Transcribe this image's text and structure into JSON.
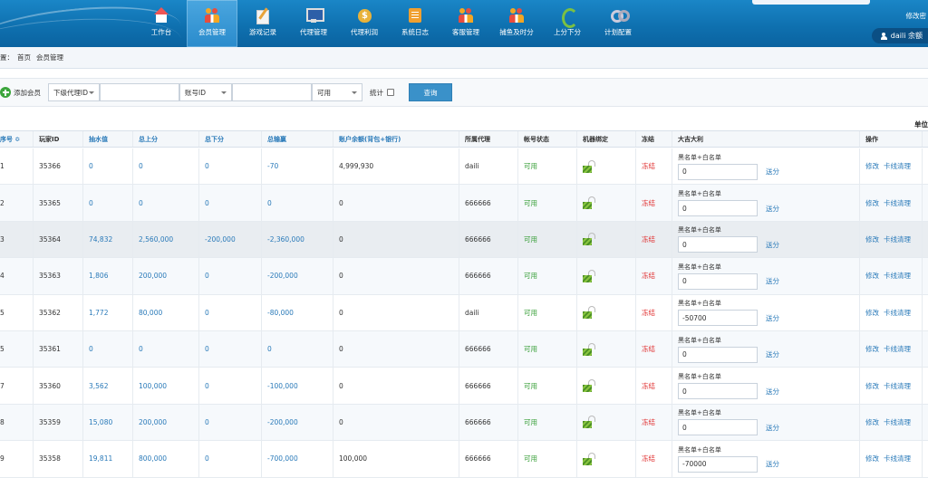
{
  "header": {
    "nav": [
      {
        "label": "工作台",
        "icon": "home-icon",
        "cls": "ico-home"
      },
      {
        "label": "会员管理",
        "icon": "members-icon",
        "cls": "ico-people",
        "active": true
      },
      {
        "label": "游戏记录",
        "icon": "edit-icon",
        "cls": "ico-edit"
      },
      {
        "label": "代理管理",
        "icon": "monitor-icon",
        "cls": "ico-monitor"
      },
      {
        "label": "代理利润",
        "icon": "money-bag-icon",
        "cls": "ico-money"
      },
      {
        "label": "系统日志",
        "icon": "log-icon",
        "cls": "ico-log"
      },
      {
        "label": "客服管理",
        "icon": "service-icon",
        "cls": "ico-people"
      },
      {
        "label": "捕鱼及时分",
        "icon": "fish-icon",
        "cls": "ico-people"
      },
      {
        "label": "上分下分",
        "icon": "refresh-icon",
        "cls": "ico-refresh"
      },
      {
        "label": "计划配置",
        "icon": "gear-icon",
        "cls": "ico-gear"
      }
    ],
    "change_password": "修改密",
    "user": "daili 余额"
  },
  "breadcrumb": {
    "prefix": "置：",
    "home": "首页",
    "current": "会员管理"
  },
  "toolbar": {
    "add_member": "添加会员",
    "agent_select": "下级代理ID",
    "account_select": "账号ID",
    "status_select": "可用",
    "stats_label": "统计",
    "query": "查询"
  },
  "unit_label": "单位",
  "table": {
    "headers": [
      "序号 ≎",
      "玩家ID",
      "抽水值",
      "总上分",
      "总下分",
      "总输赢",
      "账户余额(背包+银行)",
      "所属代理",
      "帐号状态",
      "机器绑定",
      "冻结",
      "大吉大利",
      "操作"
    ],
    "rows": [
      {
        "no": "1",
        "id": "35366",
        "rake": "0",
        "up": "0",
        "down": "0",
        "net": "-70",
        "balance": "4,999,930",
        "agent": "daili",
        "status": "可用",
        "freeze": "冻结",
        "bw_label": "黑名单+白名单",
        "bw_value": "0",
        "send": "送分",
        "edit": "修改",
        "clear": "卡线清理"
      },
      {
        "no": "2",
        "id": "35365",
        "rake": "0",
        "up": "0",
        "down": "0",
        "net": "0",
        "balance": "0",
        "agent": "666666",
        "status": "可用",
        "freeze": "冻结",
        "bw_label": "黑名单+白名单",
        "bw_value": "0",
        "send": "送分",
        "edit": "修改",
        "clear": "卡线清理"
      },
      {
        "no": "3",
        "id": "35364",
        "rake": "74,832",
        "up": "2,560,000",
        "down": "-200,000",
        "net": "-2,360,000",
        "balance": "0",
        "agent": "666666",
        "status": "可用",
        "freeze": "冻结",
        "bw_label": "黑名单+白名单",
        "bw_value": "0",
        "send": "送分",
        "edit": "修改",
        "clear": "卡线清理"
      },
      {
        "no": "4",
        "id": "35363",
        "rake": "1,806",
        "up": "200,000",
        "down": "0",
        "net": "-200,000",
        "balance": "0",
        "agent": "666666",
        "status": "可用",
        "freeze": "冻结",
        "bw_label": "黑名单+白名单",
        "bw_value": "0",
        "send": "送分",
        "edit": "修改",
        "clear": "卡线清理"
      },
      {
        "no": "5",
        "id": "35362",
        "rake": "1,772",
        "up": "80,000",
        "down": "0",
        "net": "-80,000",
        "balance": "0",
        "agent": "daili",
        "status": "可用",
        "freeze": "冻结",
        "bw_label": "黑名单+白名单",
        "bw_value": "-50700",
        "send": "送分",
        "edit": "修改",
        "clear": "卡线清理"
      },
      {
        "no": "5",
        "id": "35361",
        "rake": "0",
        "up": "0",
        "down": "0",
        "net": "0",
        "balance": "0",
        "agent": "666666",
        "status": "可用",
        "freeze": "冻结",
        "bw_label": "黑名单+白名单",
        "bw_value": "0",
        "send": "送分",
        "edit": "修改",
        "clear": "卡线清理"
      },
      {
        "no": "7",
        "id": "35360",
        "rake": "3,562",
        "up": "100,000",
        "down": "0",
        "net": "-100,000",
        "balance": "0",
        "agent": "666666",
        "status": "可用",
        "freeze": "冻结",
        "bw_label": "黑名单+白名单",
        "bw_value": "0",
        "send": "送分",
        "edit": "修改",
        "clear": "卡线清理"
      },
      {
        "no": "8",
        "id": "35359",
        "rake": "15,080",
        "up": "200,000",
        "down": "0",
        "net": "-200,000",
        "balance": "0",
        "agent": "666666",
        "status": "可用",
        "freeze": "冻结",
        "bw_label": "黑名单+白名单",
        "bw_value": "0",
        "send": "送分",
        "edit": "修改",
        "clear": "卡线清理"
      },
      {
        "no": "9",
        "id": "35358",
        "rake": "19,811",
        "up": "800,000",
        "down": "0",
        "net": "-700,000",
        "balance": "100,000",
        "agent": "666666",
        "status": "可用",
        "freeze": "冻结",
        "bw_label": "黑名单+白名单",
        "bw_value": "-70000",
        "send": "送分",
        "edit": "修改",
        "clear": "卡线清理"
      }
    ]
  },
  "colors": {
    "header_bg": "#0e6fae",
    "link": "#2a7ab9",
    "ok": "#3aa03a",
    "freeze": "#e03030",
    "highlight_row": "#e9edf1",
    "alt_row": "#f6f9fc"
  }
}
